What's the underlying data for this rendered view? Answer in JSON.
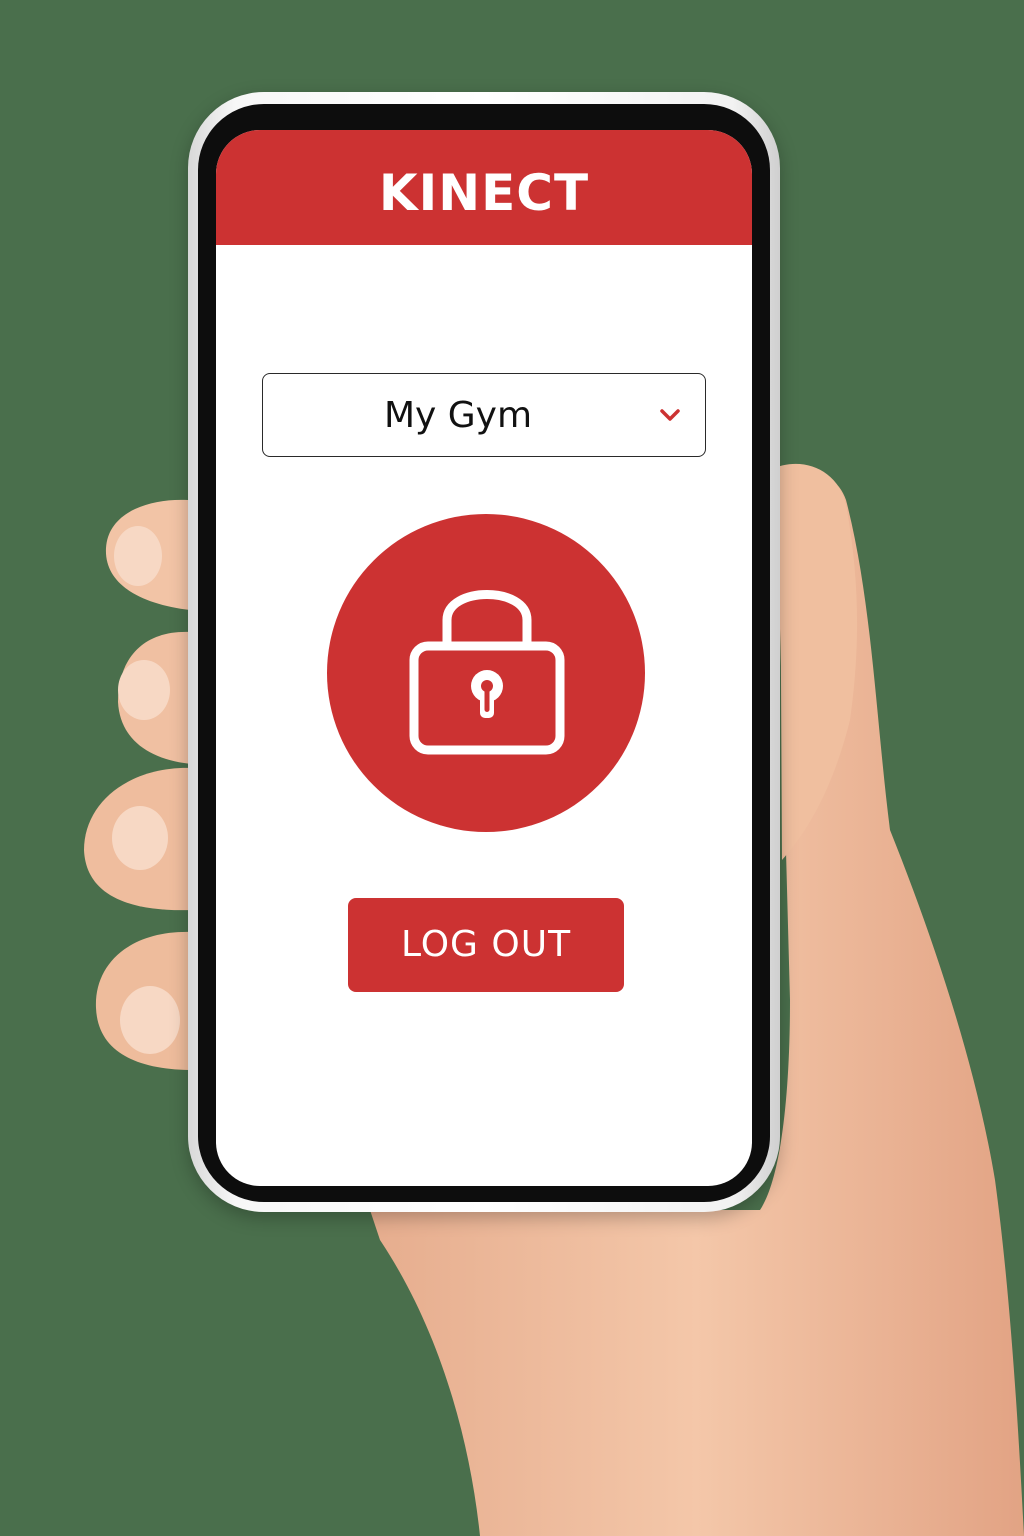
{
  "app": {
    "brand_name": "KINECT",
    "brand_color": "#cc3232"
  },
  "gym_selector": {
    "selected_value": "My Gym",
    "icon": "chevron-down-icon"
  },
  "lock_button": {
    "icon": "lock-icon",
    "state": "locked"
  },
  "logout_button": {
    "label": "LOG OUT"
  },
  "colors": {
    "background": "#4a6f4c",
    "header": "#cc3232",
    "screen": "#ffffff",
    "skin": "#f0c2a3"
  }
}
